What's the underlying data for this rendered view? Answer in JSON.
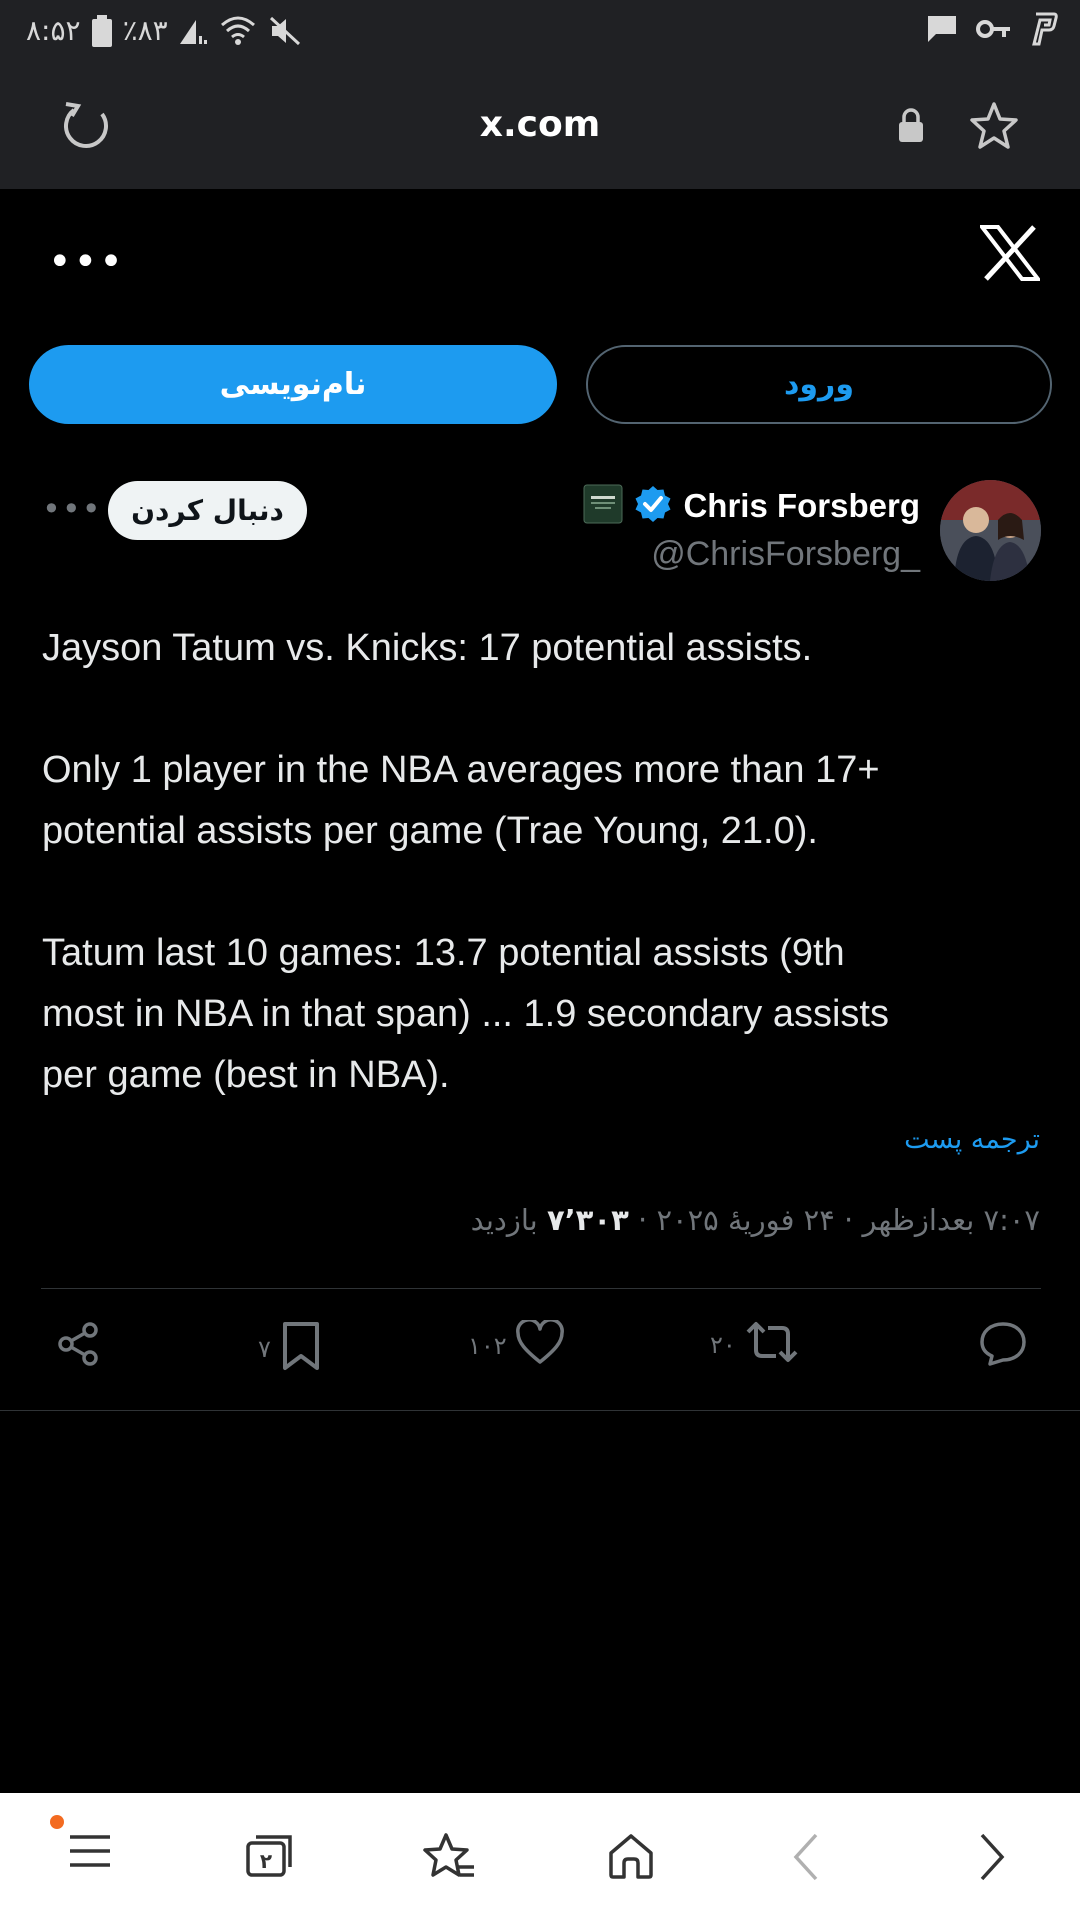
{
  "status_bar": {
    "time": "۸:۵۲",
    "battery": "٪۸۳"
  },
  "browser": {
    "url": "x.com"
  },
  "auth": {
    "signup_label": "نام‌نویسی",
    "login_label": "ورود"
  },
  "tweet": {
    "author_name": "Chris Forsberg",
    "author_handle": "@ChrisForsberg_",
    "follow_label": "دنبال کردن",
    "text_p1": "Jayson Tatum vs. Knicks: 17 potential assists.",
    "text_p2_line1": "Only 1 player in the NBA averages more than 17+",
    "text_p2_line2": "potential assists per game (Trae Young, 21.0).",
    "text_p3_line1": "Tatum last 10 games: 13.7 potential assists (9th",
    "text_p3_line2": "most in NBA in that span) ... 1.9 secondary assists",
    "text_p3_line3": "per game (best in NBA).",
    "translate_label": "ترجمه پست",
    "timestamp": "۷:۰۷ بعدازظهر · ۲۴ فوریهٔ ۲۰۲۵ · ",
    "views_count": "۷٬۳۰۳",
    "views_label": " بازدید"
  },
  "actions": {
    "bookmarks": "۷",
    "likes": "۱۰۲",
    "retweets": "۲۰"
  },
  "colors": {
    "accent": "#1d9bf0",
    "background": "#000000",
    "muted": "#71767b",
    "notification_dot": "#f36b21"
  }
}
